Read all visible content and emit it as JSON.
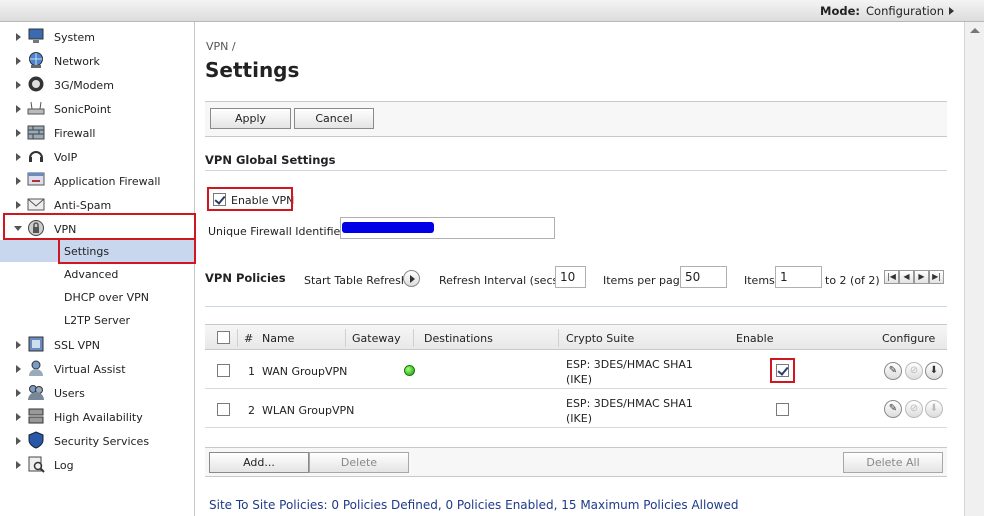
{
  "header": {
    "mode_label": "Mode:",
    "mode_value": "Configuration"
  },
  "sidebar": {
    "items": [
      {
        "label": "System",
        "icon": "monitor-icon"
      },
      {
        "label": "Network",
        "icon": "globe-icon"
      },
      {
        "label": "3G/Modem",
        "icon": "modem-icon"
      },
      {
        "label": "SonicPoint",
        "icon": "access-point-icon"
      },
      {
        "label": "Firewall",
        "icon": "firewall-icon"
      },
      {
        "label": "VoIP",
        "icon": "headset-icon"
      },
      {
        "label": "Application Firewall",
        "icon": "app-firewall-icon"
      },
      {
        "label": "Anti-Spam",
        "icon": "envelope-icon"
      },
      {
        "label": "VPN",
        "icon": "vpn-lock-icon"
      }
    ],
    "vpn_sub_items": [
      "Settings",
      "Advanced",
      "DHCP over VPN",
      "L2TP Server"
    ],
    "items_after": [
      {
        "label": "SSL VPN",
        "icon": "ssl-vpn-icon"
      },
      {
        "label": "Virtual Assist",
        "icon": "virtual-assist-icon"
      },
      {
        "label": "Users",
        "icon": "users-icon"
      },
      {
        "label": "High Availability",
        "icon": "server-icon"
      },
      {
        "label": "Security Services",
        "icon": "shield-icon"
      },
      {
        "label": "Log",
        "icon": "log-icon"
      }
    ]
  },
  "main": {
    "breadcrumb": "VPN /",
    "title": "Settings",
    "toolbar": {
      "apply": "Apply",
      "cancel": "Cancel"
    },
    "global_settings": {
      "title": "VPN Global Settings",
      "enable_vpn_label": "Enable VPN",
      "enable_vpn_checked": true,
      "uid_label": "Unique Firewall Identifier:"
    },
    "policies": {
      "title": "VPN Policies",
      "start_refresh": "Start Table Refresh",
      "refresh_interval_label": "Refresh Interval (secs)",
      "refresh_interval_value": "10",
      "items_per_page_label": "Items per page",
      "items_per_page_value": "50",
      "items_label": "Items",
      "items_value": "1",
      "items_range": "to 2 (of 2)",
      "columns": [
        "#",
        "Name",
        "Gateway",
        "Destinations",
        "Crypto Suite",
        "Enable",
        "Configure"
      ],
      "rows": [
        {
          "num": "1",
          "name": "WAN GroupVPN",
          "crypto1": "ESP: 3DES/HMAC SHA1",
          "crypto2": "(IKE)",
          "enabled": true,
          "gateway_status": "green"
        },
        {
          "num": "2",
          "name": "WLAN GroupVPN",
          "crypto1": "ESP: 3DES/HMAC SHA1",
          "crypto2": "(IKE)",
          "enabled": false,
          "gateway_status": ""
        }
      ],
      "add_button": "Add...",
      "delete_button": "Delete",
      "delete_all_button": "Delete All",
      "summary": "Site To Site Policies: 0 Policies Defined, 0 Policies Enabled, 15 Maximum Policies Allowed"
    }
  },
  "colors": {
    "highlight_red": "#d0161e",
    "selected_nav": "#c9d7ee",
    "summary_blue": "#1e3a8a",
    "status_green": "#1a9a0a"
  }
}
